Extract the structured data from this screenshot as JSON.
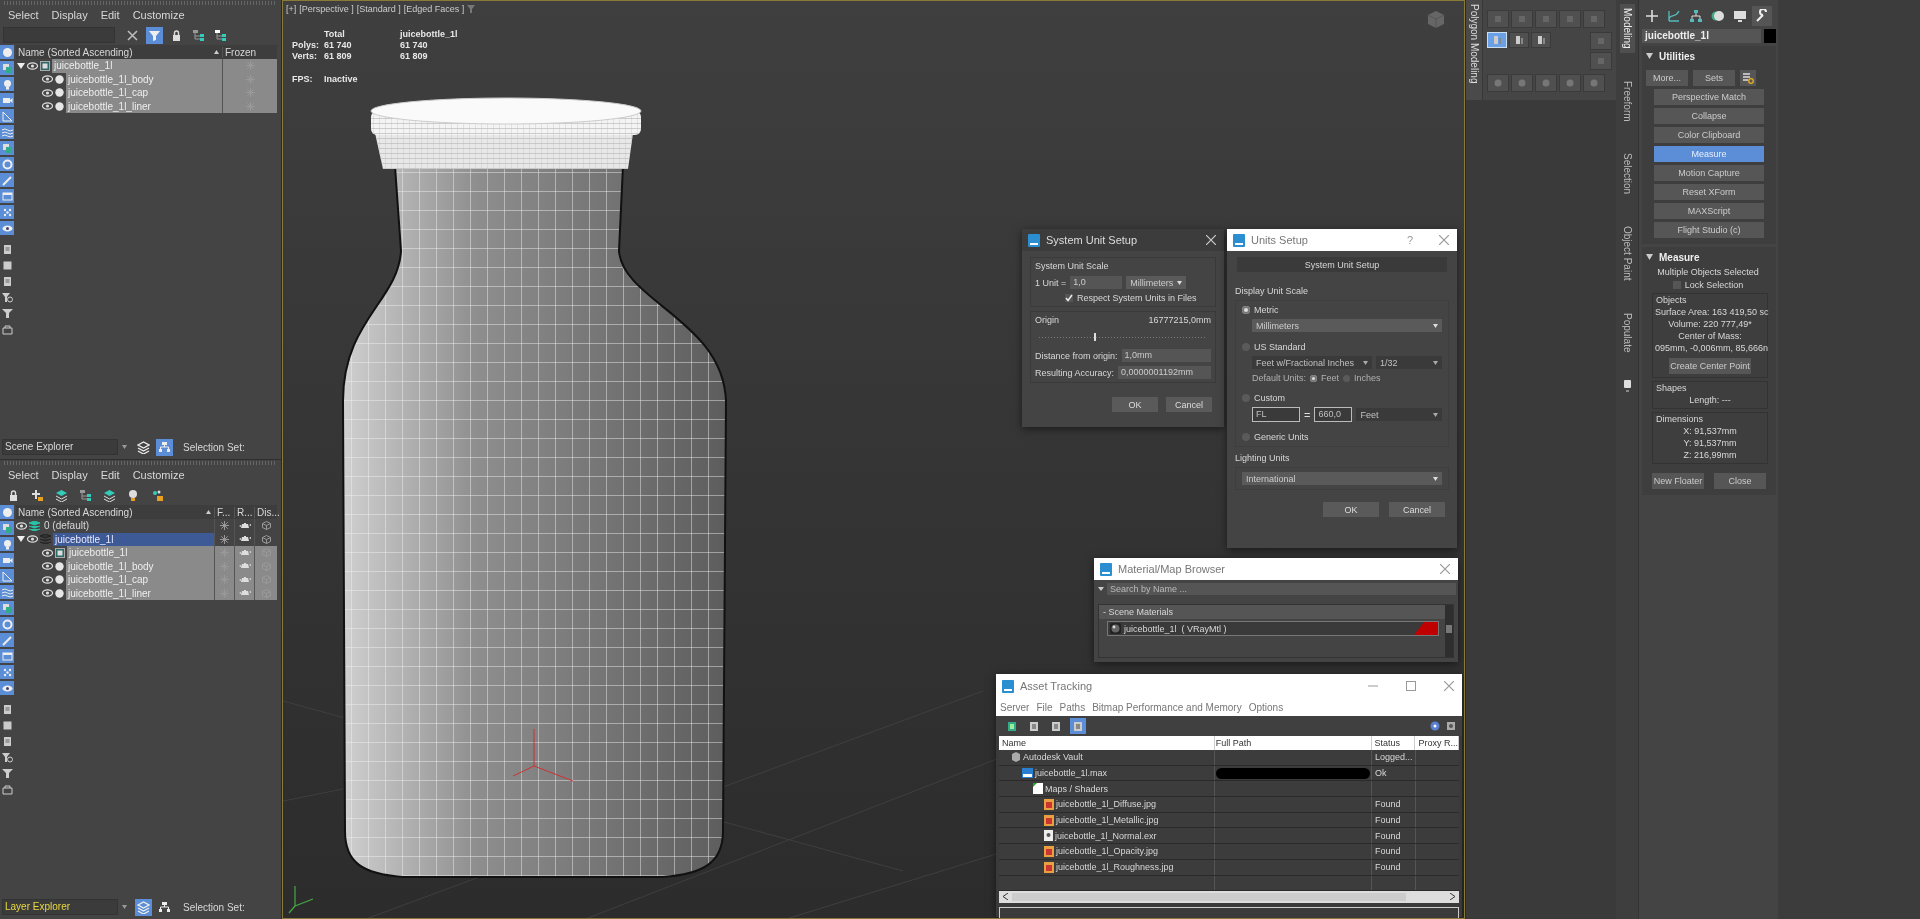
{
  "scene_explorer": {
    "menu": [
      "Select",
      "Display",
      "Edit",
      "Customize"
    ],
    "toolbar": [
      {
        "on": false
      },
      {
        "on": true
      },
      {
        "on": false
      },
      {
        "on": false
      },
      {
        "on": false
      }
    ],
    "filters": [
      {
        "on": true
      },
      {
        "on": true
      },
      {
        "on": true
      },
      {
        "on": true
      },
      {
        "on": true
      },
      {
        "on": true
      },
      {
        "on": true
      },
      {
        "on": true
      },
      {
        "on": true
      },
      {
        "on": true
      },
      {
        "on": true
      },
      {
        "on": true
      },
      {
        "on": false
      },
      {
        "on": false
      },
      {
        "on": false
      },
      {
        "on": false
      },
      {
        "on": false
      },
      {
        "on": false
      }
    ],
    "columns": [
      "Name (Sorted Ascending)",
      "Frozen"
    ],
    "rows": [
      {
        "name": "juicebottle_1l",
        "kind": "group",
        "selected": true,
        "expanded": true,
        "children": [
          {
            "name": "juicebottle_1l_body",
            "kind": "object",
            "selected": true
          },
          {
            "name": "juicebottle_1l_cap",
            "kind": "object",
            "selected": true
          },
          {
            "name": "juicebottle_1l_liner",
            "kind": "object",
            "selected": true
          }
        ]
      }
    ],
    "explorer": "Scene Explorer",
    "mode_buttons": [
      {
        "on": false
      },
      {
        "on": true
      }
    ],
    "selection_set": "Selection Set:"
  },
  "layer_explorer": {
    "menu": [
      "Select",
      "Display",
      "Edit",
      "Customize"
    ],
    "filters": [
      {
        "on": true
      },
      {
        "on": true
      },
      {
        "on": true
      },
      {
        "on": true
      },
      {
        "on": true
      },
      {
        "on": true
      },
      {
        "on": true
      },
      {
        "on": true
      },
      {
        "on": true
      },
      {
        "on": true
      },
      {
        "on": true
      },
      {
        "on": true
      },
      {
        "on": false
      },
      {
        "on": false
      },
      {
        "on": false
      },
      {
        "on": false
      },
      {
        "on": false
      },
      {
        "on": false
      }
    ],
    "columns": [
      "Name (Sorted Ascending)",
      "F...",
      "R...",
      "Dis..."
    ],
    "rows": [
      {
        "name": "0 (default)",
        "kind": "layer",
        "selected": false
      },
      {
        "name": "juicebottle_1l",
        "kind": "layer",
        "selected": true,
        "expanded": true,
        "children": [
          {
            "name": "juicebottle_1l",
            "kind": "group",
            "selected": true
          },
          {
            "name": "juicebottle_1l_body",
            "kind": "object",
            "selected": true
          },
          {
            "name": "juicebottle_1l_cap",
            "kind": "object",
            "selected": true
          },
          {
            "name": "juicebottle_1l_liner",
            "kind": "object",
            "selected": true
          }
        ]
      }
    ],
    "explorer": "Layer Explorer",
    "mode_buttons": [
      {
        "on": true
      },
      {
        "on": false
      }
    ],
    "selection_set": "Selection Set:"
  },
  "viewport": {
    "labels": [
      "[+]",
      "[Perspective ]",
      "[Standard ]",
      "[Edged Faces ]"
    ],
    "stats": {
      "columns": [
        "Total",
        "juicebottle_1l"
      ],
      "rows": [
        {
          "label": "Polys:",
          "values": [
            "61 740",
            "61 740"
          ]
        },
        {
          "label": "Verts:",
          "values": [
            "61 809",
            "61 809"
          ]
        }
      ],
      "fps_label": "FPS:",
      "fps_value": "Inactive"
    }
  },
  "system_unit_setup": {
    "title": "System Unit Setup",
    "group": "System Unit Scale",
    "unit_label": "1 Unit =",
    "unit_value": "1,0",
    "unit_type": "Millimeters",
    "respect": {
      "label": "Respect System Units in Files",
      "checked": true
    },
    "origin_label": "Origin",
    "origin_value": "16777215,0mm",
    "origin_slider": {
      "level": 0.33
    },
    "distance": {
      "label": "Distance from origin:",
      "value": "1,0mm"
    },
    "accuracy": {
      "label": "Resulting Accuracy:",
      "value": "0,0000001192mm"
    },
    "buttons": [
      "OK",
      "Cancel"
    ]
  },
  "units_setup": {
    "title": "Units Setup",
    "help": "?",
    "button": "System Unit Setup",
    "display_group": "Display Unit Scale",
    "metric": {
      "label": "Metric",
      "selected": true,
      "unit": "Millimeters"
    },
    "us_standard": {
      "label": "US Standard",
      "selected": false,
      "disabled": true,
      "unit": "Feet w/Fractional Inches",
      "fraction": "1/32",
      "default_units_label": "Default Units:",
      "default_units": [
        {
          "label": "Feet",
          "selected": true
        },
        {
          "label": "Inches",
          "selected": false
        }
      ]
    },
    "custom": {
      "label": "Custom",
      "selected": false,
      "disabled": true,
      "name": "FL",
      "equals": "=",
      "value": "660,0",
      "unit": "Feet"
    },
    "generic": {
      "label": "Generic Units",
      "selected": false
    },
    "lighting_group": "Lighting Units",
    "lighting": "International",
    "buttons": [
      "OK",
      "Cancel"
    ]
  },
  "material_browser": {
    "title": "Material/Map Browser",
    "search_placeholder": "Search by Name ...",
    "section": "- Scene Materials",
    "materials": [
      "juicebottle_1l  ( VRayMtl )"
    ]
  },
  "asset_tracking": {
    "title": "Asset Tracking",
    "menu": [
      "Server",
      "File",
      "Paths",
      "Bitmap Performance and Memory",
      "Options"
    ],
    "toolbar": [
      {
        "on": false
      },
      {
        "on": false
      },
      {
        "on": false
      },
      {
        "on": true
      }
    ],
    "columns": [
      "Name",
      "Full Path",
      "Status",
      "Proxy R..."
    ],
    "rows": [
      {
        "name": "Autodesk Vault",
        "kind": "vault",
        "status": "Logged...",
        "children": [
          {
            "name": "juicebottle_1l.max",
            "kind": "scene",
            "path_redacted": true,
            "status": "Ok",
            "children": [
              {
                "name": "Maps / Shaders",
                "kind": "folder",
                "children": [
                  {
                    "name": "juicebottle_1l_Diffuse.jpg",
                    "kind": "bitmap",
                    "status": "Found"
                  },
                  {
                    "name": "juicebottle_1l_Metallic.jpg",
                    "kind": "bitmap",
                    "status": "Found"
                  },
                  {
                    "name": "juicebottle_1l_Normal.exr",
                    "kind": "exr",
                    "status": "Found"
                  },
                  {
                    "name": "juicebottle_1l_Opacity.jpg",
                    "kind": "bitmap",
                    "status": "Found"
                  },
                  {
                    "name": "juicebottle_1l_Roughness.jpg",
                    "kind": "bitmap",
                    "status": "Found"
                  }
                ]
              }
            ]
          }
        ]
      }
    ]
  },
  "ribbon": {
    "title": "Polygon Modeling",
    "tools": [
      {
        "on": true
      },
      {
        "on": false
      },
      {
        "on": false
      }
    ],
    "tabs": [
      {
        "label": "Modeling",
        "selected": true
      },
      {
        "label": "Freeform",
        "selected": false
      },
      {
        "label": "Selection",
        "selected": false
      },
      {
        "label": "Object Paint",
        "selected": false
      },
      {
        "label": "Populate",
        "selected": false
      }
    ]
  },
  "command_panel": {
    "tabs": [
      {
        "selected": false
      },
      {
        "selected": false
      },
      {
        "selected": false
      },
      {
        "selected": false
      },
      {
        "selected": false
      },
      {
        "selected": true
      }
    ],
    "object_name": "juicebottle_1l",
    "utilities": {
      "title": "Utilities",
      "expanded": true,
      "top_buttons": [
        "More...",
        "Sets"
      ],
      "buttons": [
        {
          "label": "Perspective Match",
          "selected": false
        },
        {
          "label": "Collapse",
          "selected": false
        },
        {
          "label": "Color Clipboard",
          "selected": false
        },
        {
          "label": "Measure",
          "selected": true
        },
        {
          "label": "Motion Capture",
          "selected": false
        },
        {
          "label": "Reset XForm",
          "selected": false
        },
        {
          "label": "MAXScript",
          "selected": false
        },
        {
          "label": "Flight Studio (c)",
          "selected": false
        }
      ]
    },
    "measure": {
      "title": "Measure",
      "expanded": true,
      "status": "Multiple Objects Selected",
      "lock_selection": {
        "label": "Lock Selection",
        "checked": false
      },
      "objects": {
        "title": "Objects",
        "lines": [
          "Surface Area:  163 419,50 sc",
          "Volume:  220 777,49*",
          "Center of Mass:",
          "095mm, -0,006mm, 85,666n"
        ],
        "button": "Create Center Point"
      },
      "shapes": {
        "title": "Shapes",
        "lines": [
          "Length:  ---"
        ]
      },
      "dimensions": {
        "title": "Dimensions",
        "lines": [
          "X:  91,537mm",
          "Y:  91,537mm",
          "Z:  216,99mm"
        ]
      },
      "buttons": [
        "New Floater",
        "Close"
      ]
    }
  }
}
